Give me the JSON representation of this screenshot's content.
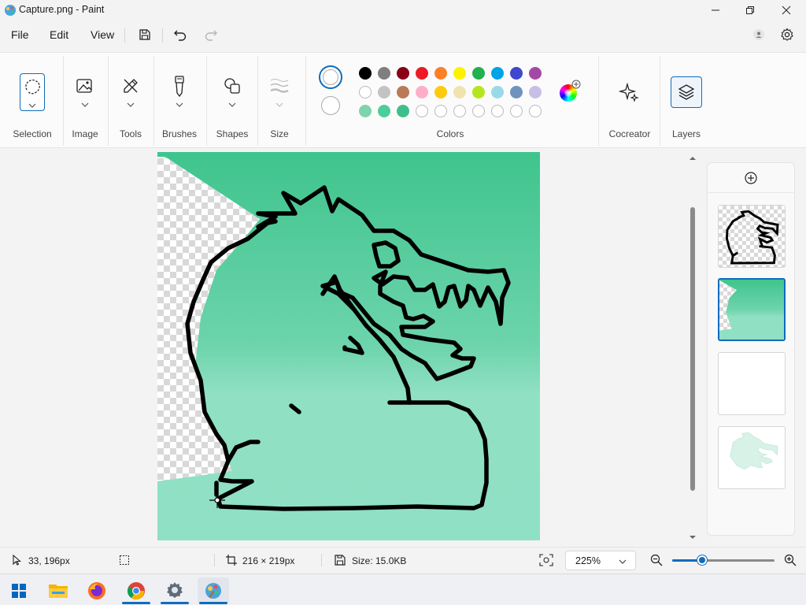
{
  "window": {
    "title": "Capture.png - Paint"
  },
  "menu": {
    "file": "File",
    "edit": "Edit",
    "view": "View"
  },
  "ribbon": {
    "groups": {
      "selection": "Selection",
      "image": "Image",
      "tools": "Tools",
      "brushes": "Brushes",
      "shapes": "Shapes",
      "size": "Size",
      "colors": "Colors",
      "cocreator": "Cocreator",
      "layers": "Layers"
    },
    "palette": {
      "row1": [
        "#000000",
        "#7f7f7f",
        "#880015",
        "#ed1c24",
        "#ff7f27",
        "#fff200",
        "#22b14c",
        "#00a2e8",
        "#3f48cc",
        "#a349a4"
      ],
      "row2": [
        "#ffffff",
        "#c3c3c3",
        "#b97a57",
        "#ffaec9",
        "#ffc90e",
        "#efe4b0",
        "#b5e61d",
        "#99d9ea",
        "#7092be",
        "#c8bfe7"
      ],
      "row3": [
        "#7fd3b0",
        "#4ccd9a",
        "#3dbf8c",
        "",
        "",
        "",
        "",
        "",
        "",
        ""
      ]
    }
  },
  "canvas": {
    "top_color": "#3fc48d",
    "bottom_color": "#8fe0c4"
  },
  "status": {
    "cursor": "33, 196px",
    "dimensions": "216 × 219px",
    "size": "Size: 15.0KB",
    "zoom": "225%",
    "zoom_fraction": 0.29
  }
}
